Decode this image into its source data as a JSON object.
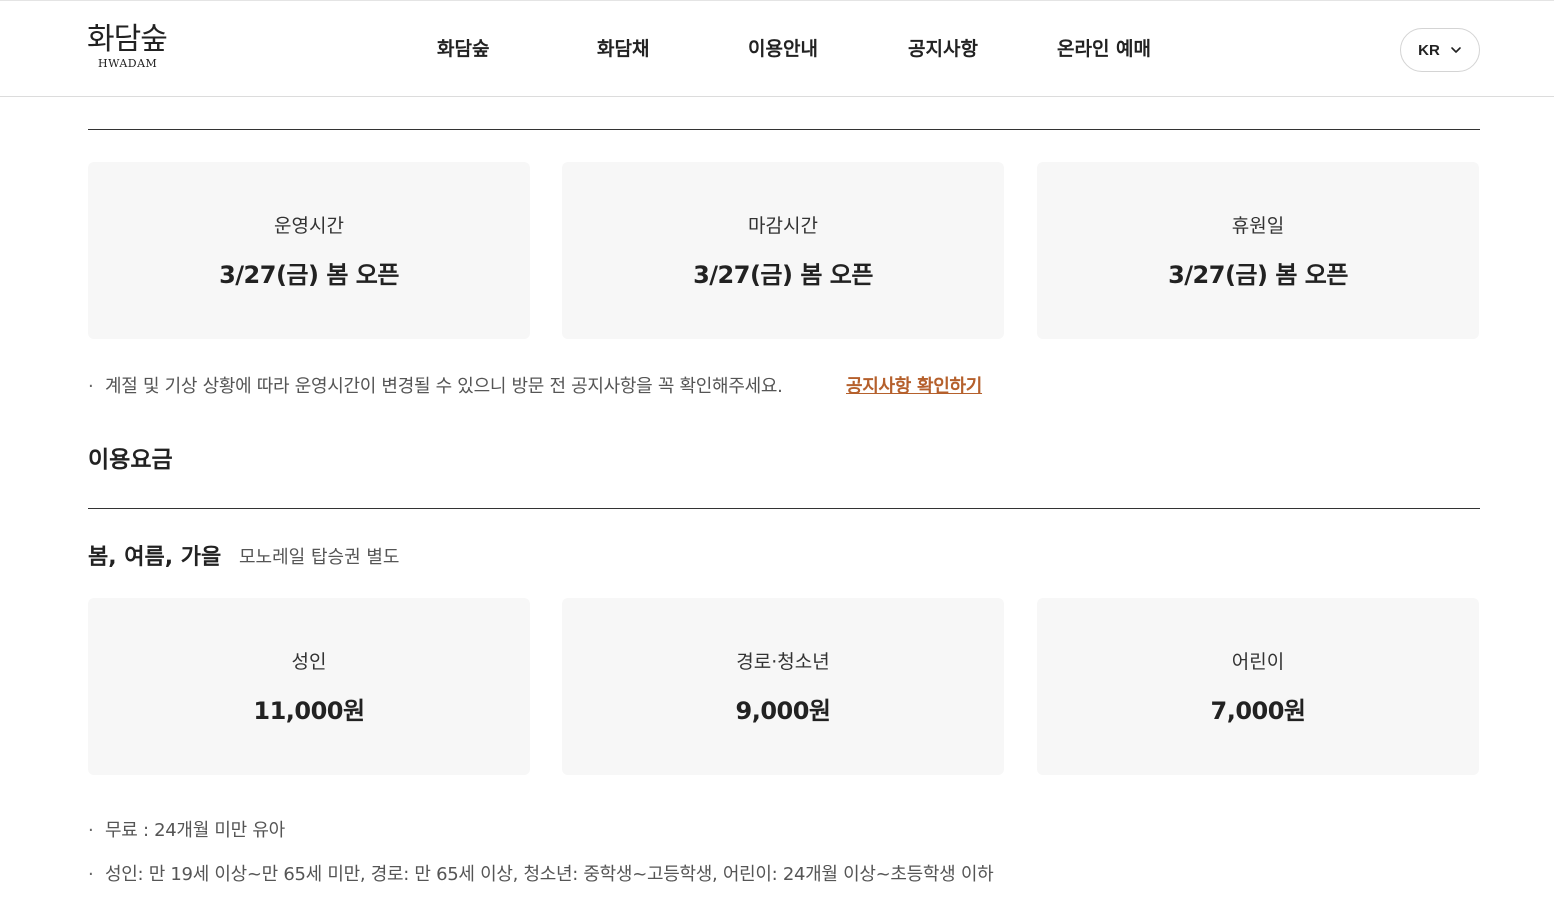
{
  "header": {
    "logo_ko": "화담숲",
    "logo_en": "HWADAM",
    "nav": [
      "화담숲",
      "화담채",
      "이용안내",
      "공지사항",
      "온라인 예매"
    ],
    "lang": "KR"
  },
  "hours": {
    "cards": [
      {
        "label": "운영시간",
        "value": "3/27(금) 봄 오픈"
      },
      {
        "label": "마감시간",
        "value": "3/27(금) 봄 오픈"
      },
      {
        "label": "휴원일",
        "value": "3/27(금) 봄 오픈"
      }
    ],
    "note": "계절 및 기상 상황에 따라 운영시간이 변경될 수 있으니 방문 전 공지사항을 꼭 확인해주세요.",
    "note_link": "공지사항 확인하기"
  },
  "fees": {
    "title": "이용요금",
    "season": "봄, 여름, 가을",
    "season_sub": "모노레일 탑승권 별도",
    "cards": [
      {
        "label": "성인",
        "value": "11,000원"
      },
      {
        "label": "경로·청소년",
        "value": "9,000원"
      },
      {
        "label": "어린이",
        "value": "7,000원"
      }
    ],
    "notes": [
      "무료 : 24개월 미만 유아",
      "성인: 만 19세 이상~만 65세 미만, 경로: 만 65세 이상, 청소년: 중학생~고등학생, 어린이: 24개월 이상~초등학생 이하"
    ],
    "bullet": "·"
  }
}
